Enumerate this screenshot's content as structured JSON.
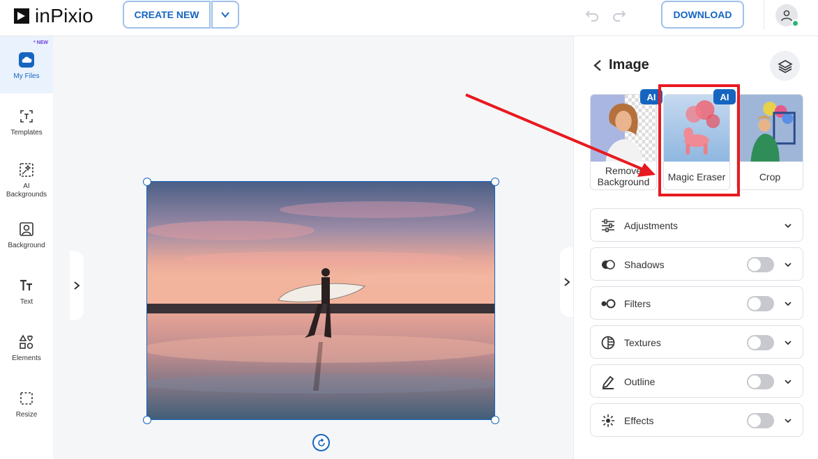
{
  "app": {
    "name": "inPixio"
  },
  "toolbar": {
    "create_new_label": "CREATE NEW",
    "download_label": "DOWNLOAD"
  },
  "sidebar": {
    "new_badge": "* NEW",
    "items": [
      {
        "label": "My Files",
        "icon": "cloud-icon"
      },
      {
        "label": "Templates",
        "icon": "templates-icon"
      },
      {
        "label": "AI Backgrounds",
        "icon": "ai-backgrounds-icon"
      },
      {
        "label": "Background",
        "icon": "background-icon"
      },
      {
        "label": "Text",
        "icon": "text-icon"
      },
      {
        "label": "Elements",
        "icon": "elements-icon"
      },
      {
        "label": "Resize",
        "icon": "resize-icon"
      }
    ]
  },
  "panel": {
    "title": "Image",
    "tools": [
      {
        "label_line1": "Remove",
        "label_line2": "Background",
        "ai": "AI"
      },
      {
        "label": "Magic Eraser",
        "ai": "AI"
      },
      {
        "label": "Crop"
      }
    ],
    "sections": [
      {
        "label": "Adjustments",
        "icon": "sliders-icon",
        "toggle": null
      },
      {
        "label": "Shadows",
        "icon": "shadows-icon",
        "toggle": false
      },
      {
        "label": "Filters",
        "icon": "filters-icon",
        "toggle": false
      },
      {
        "label": "Textures",
        "icon": "textures-icon",
        "toggle": false
      },
      {
        "label": "Outline",
        "icon": "pen-icon",
        "toggle": false
      },
      {
        "label": "Effects",
        "icon": "sparkle-icon",
        "toggle": false
      }
    ]
  },
  "colors": {
    "accent": "#1565c0",
    "annotation": "#e8191f"
  }
}
